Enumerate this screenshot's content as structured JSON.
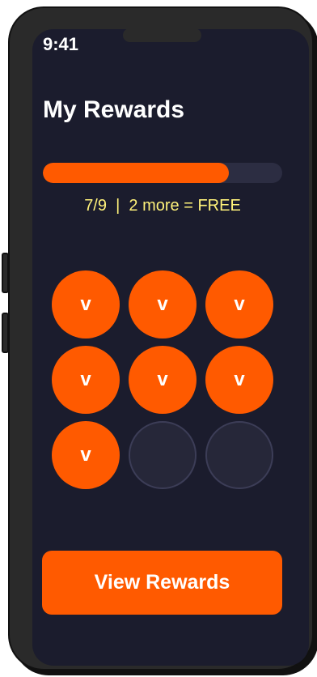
{
  "status_bar": {
    "time": "9:41"
  },
  "header": {
    "title": "My Rewards"
  },
  "progress": {
    "collected": 7,
    "total": 9,
    "label": "7/9  |  2 more = FREE"
  },
  "stamps": [
    {
      "filled": true,
      "mark": "v"
    },
    {
      "filled": true,
      "mark": "v"
    },
    {
      "filled": true,
      "mark": "v"
    },
    {
      "filled": true,
      "mark": "v"
    },
    {
      "filled": true,
      "mark": "v"
    },
    {
      "filled": true,
      "mark": "v"
    },
    {
      "filled": true,
      "mark": "v"
    },
    {
      "filled": false,
      "mark": ""
    },
    {
      "filled": false,
      "mark": ""
    }
  ],
  "cta": {
    "label": "View Rewards"
  },
  "colors": {
    "accent": "#ff5a00",
    "background": "#1b1c2d",
    "progress_text": "#fff27a",
    "empty_stamp": "#262739"
  }
}
